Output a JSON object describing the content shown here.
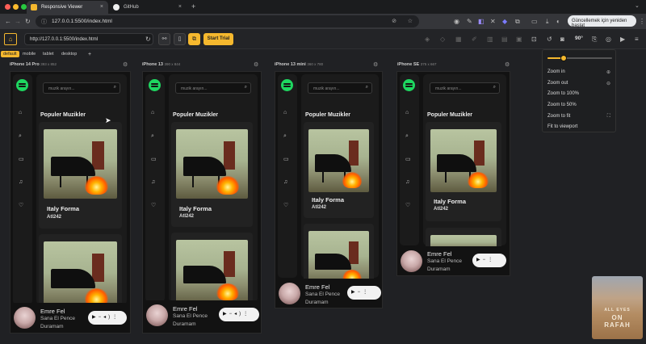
{
  "browser": {
    "tabs": [
      {
        "label": "Responsive Viewer",
        "favicon": "rv-icon"
      },
      {
        "label": "GitHub",
        "favicon": "github-icon"
      }
    ],
    "url": "127.0.0.1:5500/index.html",
    "update_label": "Güncellemek için yeniden başlat"
  },
  "toolbar": {
    "url": "http://127.0.0.1:5500/index.html",
    "start_trial": "Start Trial",
    "rotation": "90°"
  },
  "presets": [
    "default",
    "mobile",
    "tablet",
    "desktop"
  ],
  "add_preset": "+",
  "devices": [
    {
      "name": "iPhone 14 Pro",
      "size": "393 x 852"
    },
    {
      "name": "iPhone 13",
      "size": "390 x 844"
    },
    {
      "name": "iPhone 13 mini",
      "size": "360 x 780"
    },
    {
      "name": "iPhone SE",
      "size": "375 x 667"
    }
  ],
  "app": {
    "search_placeholder": "muzik arayın...",
    "section_title": "Populer Muzikler",
    "song_title": "Italy Forma",
    "song_artist": "Atl242",
    "player": {
      "artist": "Emre Fel",
      "track_line1": "Sana El Pence",
      "track_line2": "Duramam"
    }
  },
  "zoom_menu": {
    "slider_value": 0.25,
    "items": [
      "Zoom in",
      "Zoom out",
      "Zoom to 100%",
      "Zoom to 50%",
      "Zoom to fit",
      "Fit to viewport"
    ]
  },
  "thumbnail": {
    "text_line1": "ALL EYES",
    "text_line2": "ON",
    "text_line3": "RAFAH"
  },
  "colors": {
    "accent": "#f5b82e",
    "spotify": "#1ed760"
  }
}
